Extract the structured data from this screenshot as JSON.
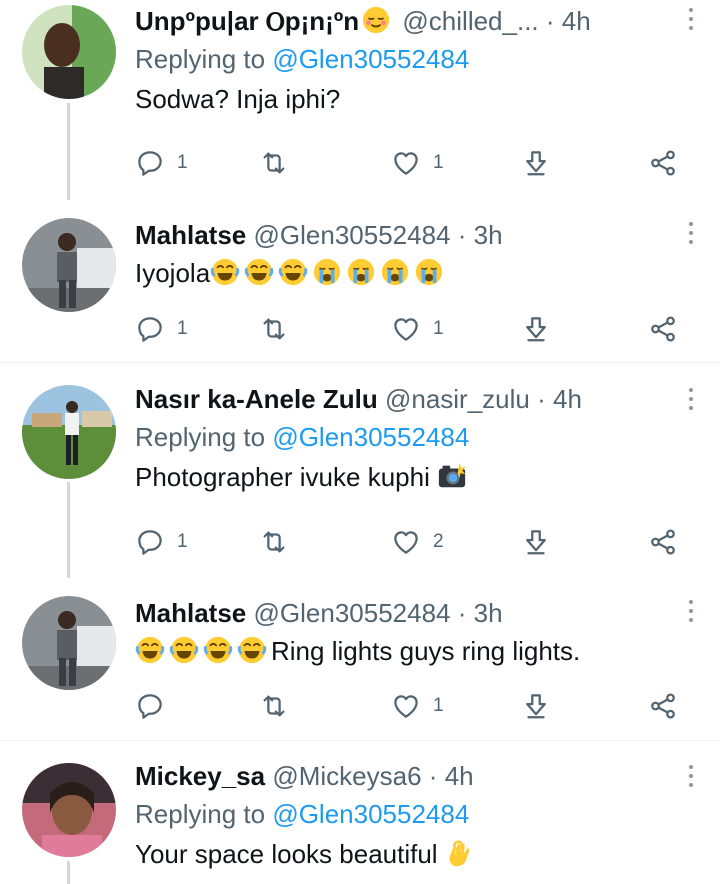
{
  "tweets": [
    {
      "name": "Unpºpu|ar Ⲟp¡n¡ºn",
      "handle": "@chilled_...",
      "time": "4h",
      "replying_prefix": "Replying to ",
      "replying_to": "@Glen30552484",
      "text": "Sodwa? Inja iphi?",
      "name_emojis": [
        "relieved-face"
      ],
      "text_emojis": [],
      "reply_count": "1",
      "retweet_count": "",
      "like_count": "1"
    },
    {
      "name": "Mahlatse",
      "handle": "@Glen30552484",
      "time": "3h",
      "replying_prefix": "",
      "replying_to": "",
      "text": "Iyojola",
      "text_emojis": [
        "joy",
        "joy",
        "joy",
        "sob",
        "sob",
        "sob",
        "sob"
      ],
      "reply_count": "1",
      "retweet_count": "",
      "like_count": "1"
    },
    {
      "name": "Nasır ka-Anele Zulu",
      "handle": "@nasir_zulu",
      "time": "4h",
      "replying_prefix": "Replying to ",
      "replying_to": "@Glen30552484",
      "text": "Photographer ivuke kuphi ",
      "text_emojis": [
        "camera-flash"
      ],
      "reply_count": "1",
      "retweet_count": "",
      "like_count": "2"
    },
    {
      "name": "Mahlatse",
      "handle": "@Glen30552484",
      "time": "3h",
      "replying_prefix": "",
      "replying_to": "",
      "text": "Ring lights guys ring lights.",
      "text_emojis_before": [
        "joy",
        "joy",
        "joy",
        "joy"
      ],
      "reply_count": "",
      "retweet_count": "",
      "like_count": "1"
    },
    {
      "name": "Mickey_sa",
      "handle": "@Mickeysa6",
      "time": "4h",
      "replying_prefix": "Replying to ",
      "replying_to": "@Glen30552484",
      "text": "Your space looks beautiful ",
      "text_emojis": [
        "ok-hand"
      ]
    }
  ],
  "separator": "·",
  "colors": {
    "link": "#1d9bf0",
    "muted": "#536471",
    "thread_line": "#cfd9de"
  },
  "icons": [
    "reply-icon",
    "retweet-icon",
    "like-icon",
    "download-icon",
    "share-icon",
    "more-icon"
  ]
}
